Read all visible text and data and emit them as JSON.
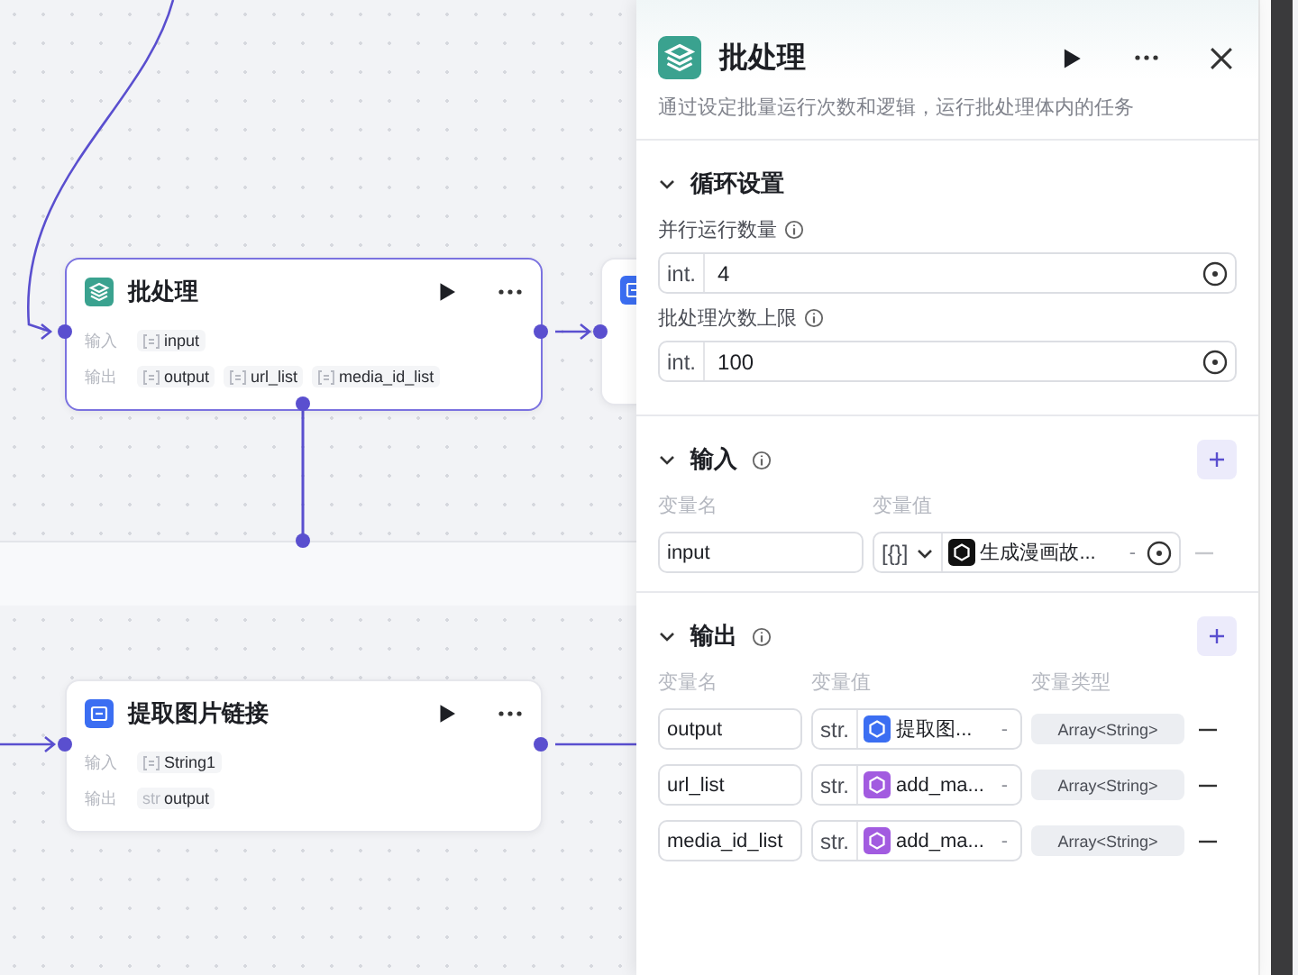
{
  "canvas": {
    "nodes": [
      {
        "title": "批处理",
        "kind": "batch",
        "selected": true,
        "input_label": "输入",
        "output_label": "输出",
        "inputs": [
          {
            "kind": "array",
            "name": "input"
          }
        ],
        "outputs": [
          {
            "kind": "array",
            "name": "output"
          },
          {
            "kind": "array",
            "name": "url_list"
          },
          {
            "kind": "array",
            "name": "media_id_list"
          }
        ]
      },
      {
        "title": "提取图片链接",
        "kind": "code",
        "selected": false,
        "input_label": "输入",
        "output_label": "输出",
        "inputs": [
          {
            "kind": "array",
            "name": "String1"
          }
        ],
        "outputs": [
          {
            "kind": "str",
            "name": "output",
            "type_label": "str"
          }
        ]
      }
    ]
  },
  "panel": {
    "title": "批处理",
    "description": "通过设定批量运行次数和逻辑，运行批处理体内的任务",
    "loop": {
      "title": "循环设置",
      "expanded": true,
      "fields": [
        {
          "label": "并行运行数量",
          "type": "int.",
          "value": "4"
        },
        {
          "label": "批处理次数上限",
          "type": "int.",
          "value": "100"
        }
      ]
    },
    "input": {
      "title": "输入",
      "expanded": true,
      "columns": [
        "变量名",
        "变量值"
      ],
      "rows": [
        {
          "name": "input",
          "type": "[{}]",
          "source": "生成漫画故...",
          "color": "#111111",
          "dash": "-"
        }
      ]
    },
    "output": {
      "title": "输出",
      "expanded": true,
      "columns": [
        "变量名",
        "变量值",
        "变量类型"
      ],
      "rows": [
        {
          "name": "output",
          "type": "str.",
          "source": "提取图...",
          "color": "#3b6ef2",
          "dash": "-",
          "value_type": "Array<String>"
        },
        {
          "name": "url_list",
          "type": "str.",
          "source": "add_ma...",
          "color": "#a25be0",
          "dash": "-",
          "value_type": "Array<String>"
        },
        {
          "name": "media_id_list",
          "type": "str.",
          "source": "add_ma...",
          "color": "#a25be0",
          "dash": "-",
          "value_type": "Array<String>"
        }
      ]
    }
  }
}
